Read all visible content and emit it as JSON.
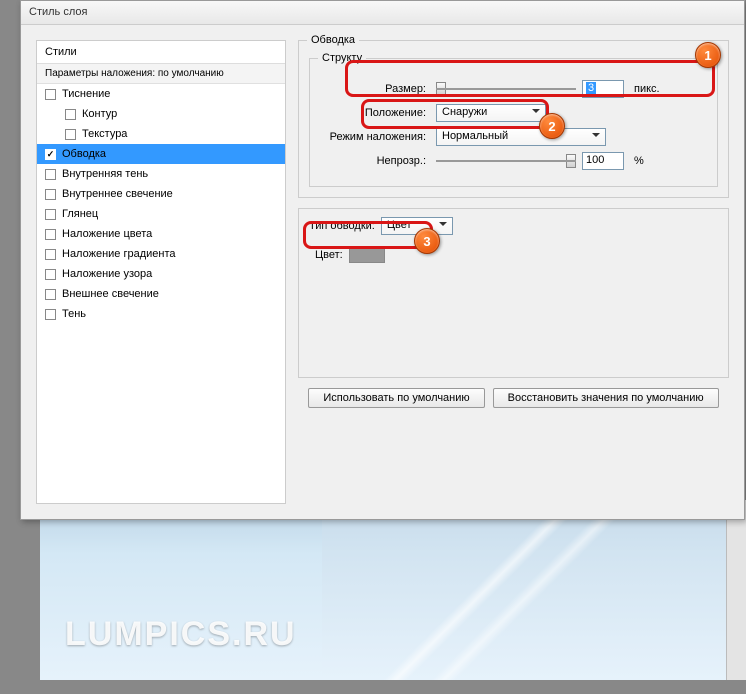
{
  "dialog_title": "Стиль слоя",
  "sidebar": {
    "head": "Стили",
    "sub": "Параметры наложения: по умолчанию",
    "items": [
      {
        "label": "Тиснение",
        "indent": false,
        "checked": false
      },
      {
        "label": "Контур",
        "indent": true,
        "checked": false
      },
      {
        "label": "Текстура",
        "indent": true,
        "checked": false
      },
      {
        "label": "Обводка",
        "indent": false,
        "checked": true,
        "selected": true
      },
      {
        "label": "Внутренняя тень",
        "indent": false,
        "checked": false
      },
      {
        "label": "Внутреннее свечение",
        "indent": false,
        "checked": false
      },
      {
        "label": "Глянец",
        "indent": false,
        "checked": false
      },
      {
        "label": "Наложение цвета",
        "indent": false,
        "checked": false
      },
      {
        "label": "Наложение градиента",
        "indent": false,
        "checked": false
      },
      {
        "label": "Наложение узора",
        "indent": false,
        "checked": false
      },
      {
        "label": "Внешнее свечение",
        "indent": false,
        "checked": false
      },
      {
        "label": "Тень",
        "indent": false,
        "checked": false
      }
    ]
  },
  "panel": {
    "group_title": "Обводка",
    "structure_title": "Структу",
    "size_label": "Размер:",
    "size_value": "3",
    "size_unit": "пикс.",
    "position_label": "Положение:",
    "position_value": "Снаружи",
    "blend_label": "Режим наложения:",
    "blend_value": "Нормальный",
    "opacity_label": "Непрозр.:",
    "opacity_value": "100",
    "opacity_unit": "%",
    "filltype_label": "Тип обводки:",
    "filltype_value": "Цвет",
    "color_label": "Цвет:",
    "color_value": "#989898",
    "btn_default": "Использовать по умолчанию",
    "btn_reset": "Восстановить значения по умолчанию"
  },
  "watermark": "LUMPICS.RU",
  "callouts": {
    "n1": "1",
    "n2": "2",
    "n3": "3"
  }
}
